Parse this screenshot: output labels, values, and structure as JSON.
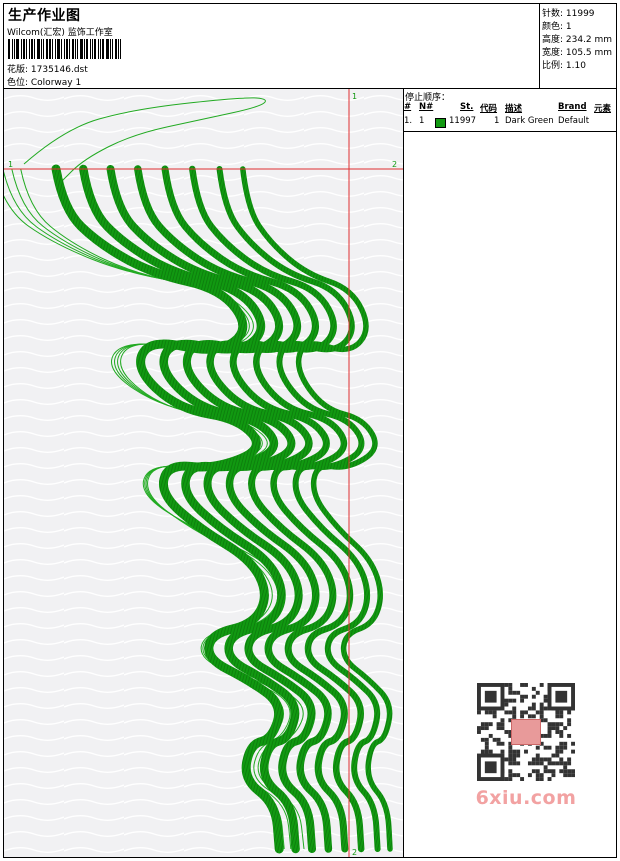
{
  "header": {
    "title": "生产作业图",
    "company": "Wilcom(汇宏) 监饰工作室",
    "design_label": "花版:  1735146.dst",
    "colorway_label": "色位:  Colorway 1"
  },
  "stats": {
    "stitches": "针数: 11999",
    "colors": "颜色: 1",
    "height": "高度: 234.2 mm",
    "width": "宽度: 105.5 mm",
    "scale": "比例: 1.10"
  },
  "stop_sequence": {
    "title": "停止顺序：",
    "columns": [
      "#",
      "N#",
      "St.",
      "代码",
      "描述",
      "Brand",
      "元素"
    ],
    "rows": [
      {
        "index": "1.",
        "needle": "1",
        "stitches": "11997",
        "code": "1",
        "description": "Dark Green",
        "brand": "Default",
        "color": "#119911"
      }
    ]
  },
  "markers": {
    "h_left": "1",
    "h_right": "2",
    "v_top": "1",
    "v_bottom": "2"
  },
  "colors": {
    "thread": "#119911",
    "outline": "#22aa22",
    "guide": "#e03030"
  },
  "watermark": {
    "text": "6xiu.com",
    "seal_icon": "seal-icon",
    "qr_icon": "qr-code-icon"
  }
}
